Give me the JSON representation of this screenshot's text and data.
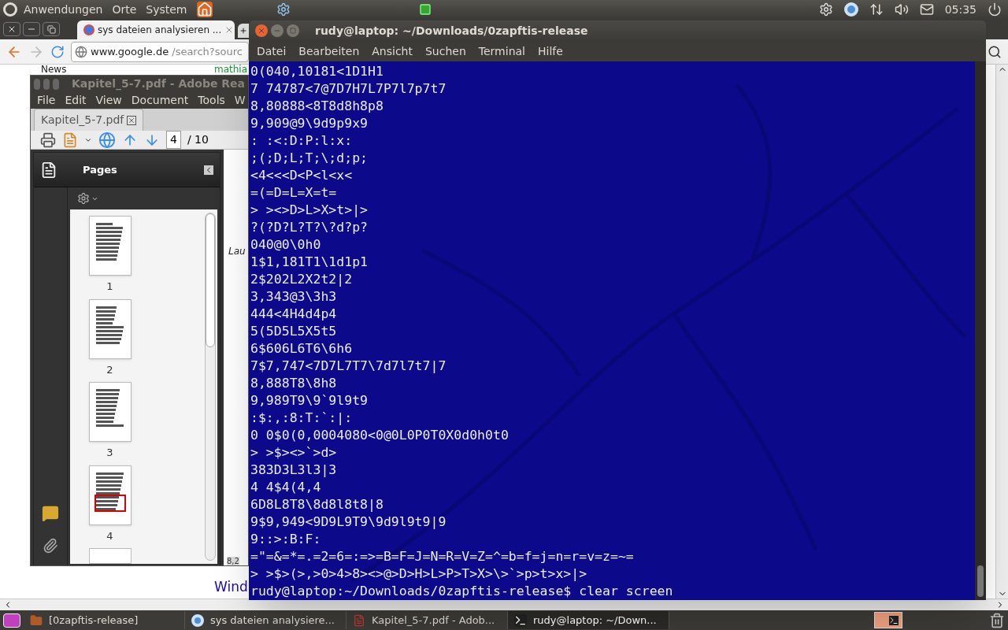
{
  "top_panel": {
    "menus": [
      "Anwendungen",
      "Orte",
      "System"
    ],
    "clock": "05:35"
  },
  "browser": {
    "tab_title": "sys dateien analysieren ...",
    "url_host": "www.google.de",
    "url_path": "/search?sourc",
    "news": "News",
    "snippet": "mathia",
    "link": "Wind"
  },
  "pdf_reader": {
    "title": "Kapitel_5-7.pdf - Adobe Rea",
    "menus": [
      "File",
      "Edit",
      "View",
      "Document",
      "Tools",
      "W"
    ],
    "doc_tab": "Kapitel_5-7.pdf",
    "page_field": "4",
    "page_total": "/ 10",
    "panel_title": "Pages",
    "thumbnails": [
      {
        "label": "1",
        "selected": false
      },
      {
        "label": "2",
        "selected": false
      },
      {
        "label": "3",
        "selected": false
      },
      {
        "label": "4",
        "selected": true
      }
    ],
    "doc_text": "Lau",
    "zoom": "8,2"
  },
  "terminal": {
    "title": "rudy@laptop: ~/Downloads/0zapftis-release",
    "menus": [
      "Datei",
      "Bearbeiten",
      "Ansicht",
      "Suchen",
      "Terminal",
      "Hilfe"
    ],
    "lines": [
      "0(040,10181<1D1H1",
      "7 74787<7@7D7H7L7P7l7p7t7",
      "8,80888<8T8d8h8p8",
      "9,909@9\\9d9p9x9",
      ": :<:D:P:l:x:",
      ";(;D;L;T;\\;d;p;",
      "<4<<<D<P<l<x<",
      "=(=D=L=X=t=",
      "> ><>D>L>X>t>|>",
      "?(?D?L?T?\\?d?p?",
      "040@0\\0h0",
      "1$1,181T1\\1d1p1",
      "2$202L2X2t2|2",
      "3,343@3\\3h3",
      "444<4H4d4p4",
      "5(5D5L5X5t5",
      "6$606L6T6\\6h6",
      "7$7,747<7D7L7T7\\7d7l7t7|7",
      "8,888T8\\8h8",
      "9,989T9\\9`9l9t9",
      ":$:,:8:T:`:|:",
      "0 0$0(0,0004080<0@0L0P0T0X0d0h0t0",
      "> >$><>`>d>",
      "383D3L3l3|3",
      "4 4$4(4,4",
      "6D8L8T8\\8d8l8t8|8",
      "9$9,949<9D9L9T9\\9d9l9t9|9",
      "9::>:B:F:",
      "=\"=&=*=.=2=6=:=>=B=F=J=N=R=V=Z=^=b=f=j=n=r=v=z=~=",
      "> >$>(>,>0>4>8><>@>D>H>L>P>T>X>\\>`>p>t>x>|>",
      "rudy@laptop:~/Downloads/0zapftis-release$ clear screen"
    ]
  },
  "taskbar": {
    "items": [
      {
        "kind": "folder",
        "label": "[0zapftis-release]",
        "selected": false
      },
      {
        "kind": "browser",
        "label": "sys dateien analysiere...",
        "selected": false
      },
      {
        "kind": "pdf",
        "label": "Kapitel_5-7.pdf - Adob...",
        "selected": false
      },
      {
        "kind": "terminal",
        "label": "rudy@laptop: ~/Down...",
        "selected": true
      }
    ]
  }
}
